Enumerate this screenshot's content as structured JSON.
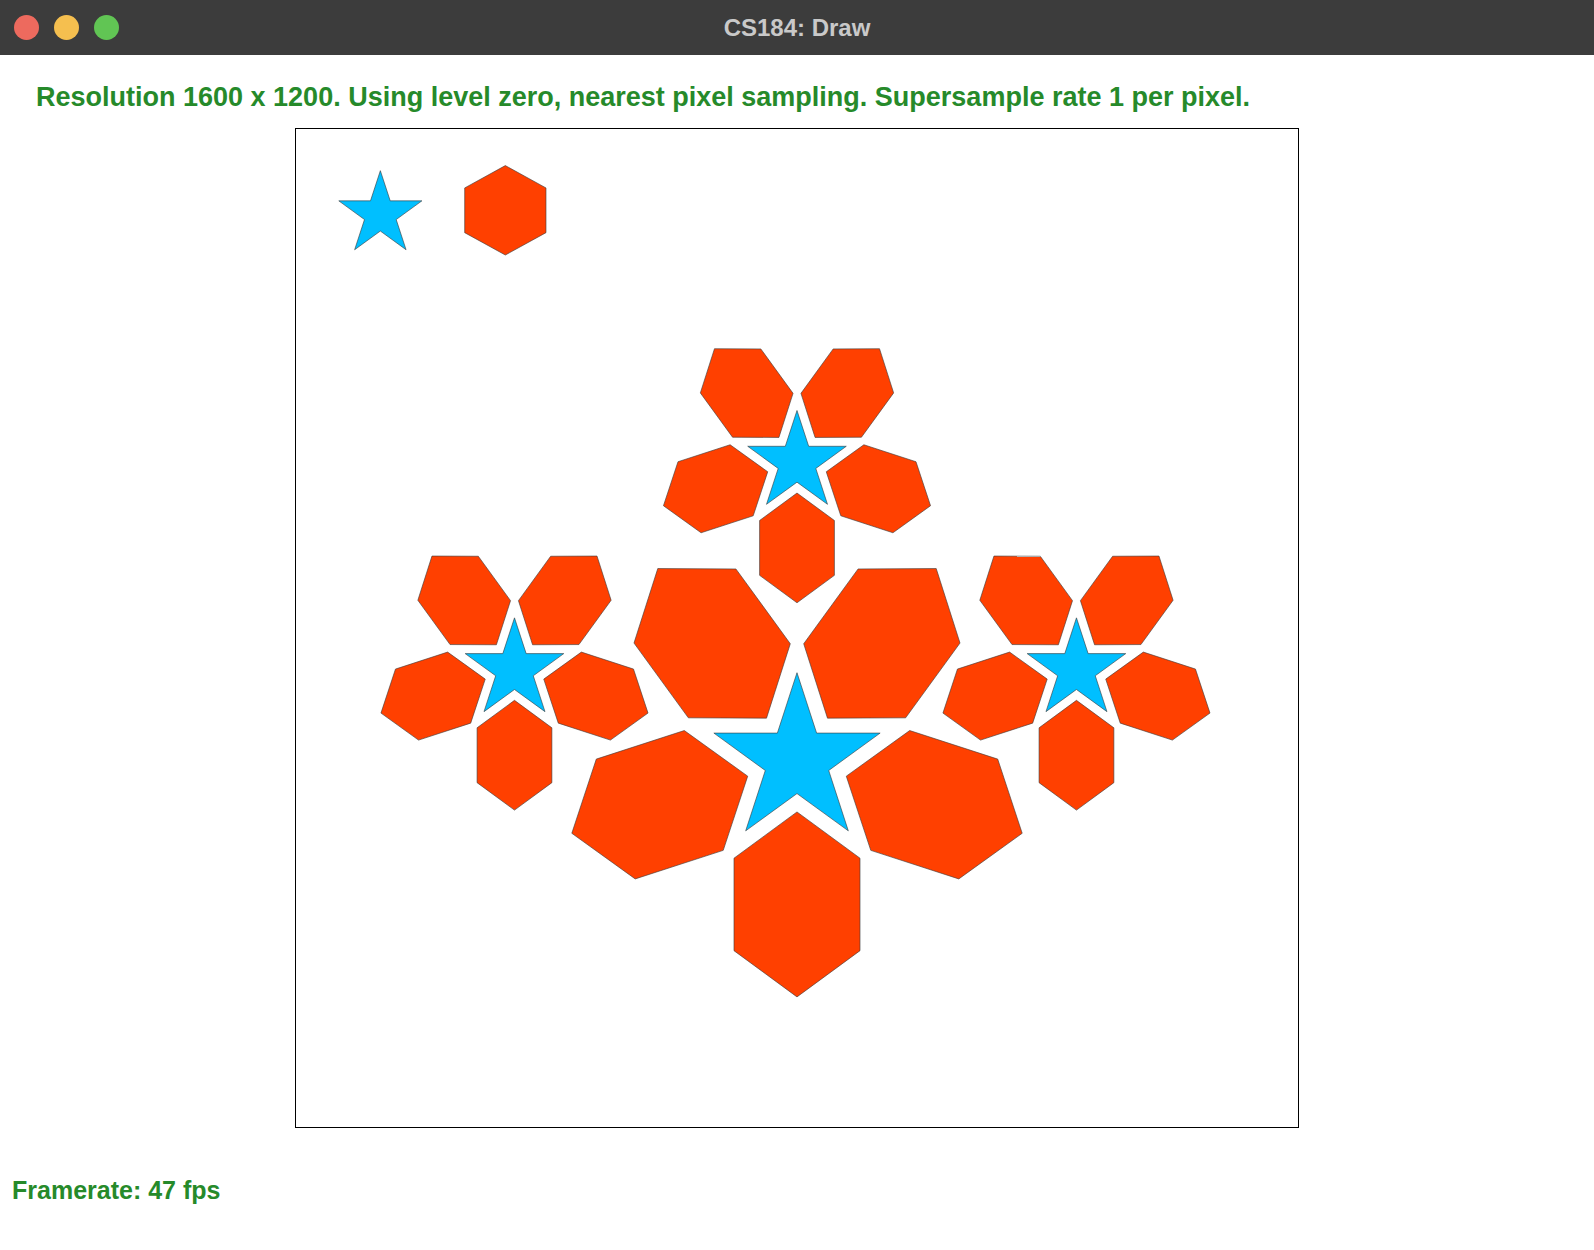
{
  "window": {
    "title": "CS184: Draw"
  },
  "status": "Resolution 1600 x 1200. Using level zero, nearest pixel sampling. Supersample rate 1 per pixel.",
  "samples": [
    {
      "kind": "star",
      "color": "#00bfff"
    },
    {
      "kind": "hexagon",
      "color": "#ff4000"
    }
  ],
  "flowers": [
    {
      "star_color": "#00bfff",
      "petal_color": "#ff4000",
      "petals": 5
    },
    {
      "star_color": "#00bfff",
      "petal_color": "#ff4000",
      "petals": 5
    },
    {
      "star_color": "#00bfff",
      "petal_color": "#ff4000",
      "petals": 5
    },
    {
      "star_color": "#00bfff",
      "petal_color": "#ff4000",
      "petals": 5
    }
  ],
  "framerate": "Framerate: 47 fps"
}
